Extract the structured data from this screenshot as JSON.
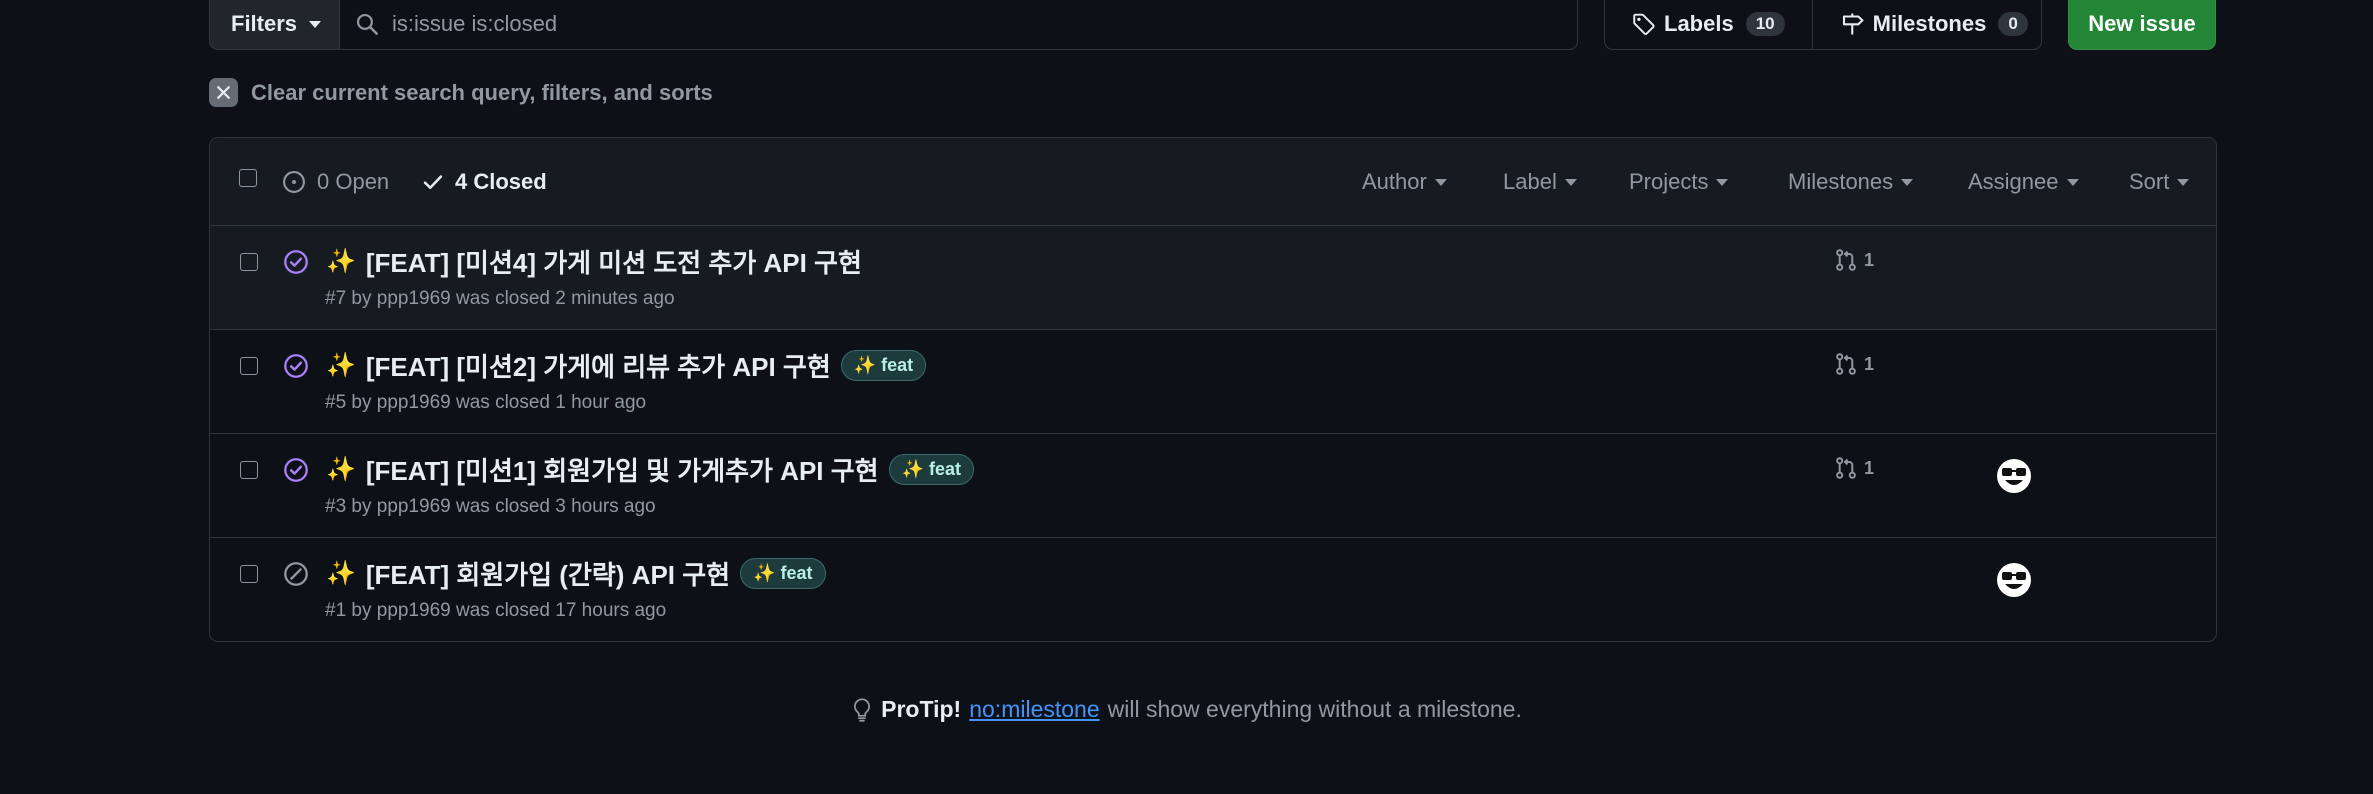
{
  "toolbar": {
    "filters_label": "Filters",
    "search_placeholder": "is:issue is:closed",
    "labels_label": "Labels",
    "labels_count": "10",
    "milestones_label": "Milestones",
    "milestones_count": "0",
    "new_issue_label": "New issue"
  },
  "clear_filters": {
    "label": "Clear current search query, filters, and sorts"
  },
  "issues_header": {
    "open_label": "0 Open",
    "closed_label": "4 Closed",
    "filters": [
      "Author",
      "Label",
      "Projects",
      "Milestones",
      "Assignee",
      "Sort"
    ]
  },
  "issues": [
    {
      "emoji": "✨",
      "title": "[FEAT] [미션4] 가게 미션 도전 추가 API 구현",
      "label": "",
      "meta": "#7 by ppp1969 was closed 2 minutes ago",
      "linked_prs": "1",
      "state": "completed",
      "has_assignee": false
    },
    {
      "emoji": "✨",
      "title": "[FEAT] [미션2] 가게에 리뷰 추가 API 구현",
      "label": "✨ feat",
      "meta": "#5 by ppp1969 was closed 1 hour ago",
      "linked_prs": "1",
      "state": "completed",
      "has_assignee": false
    },
    {
      "emoji": "✨",
      "title": "[FEAT] [미션1] 회원가입 및 가게추가 API 구현",
      "label": "✨ feat",
      "meta": "#3 by ppp1969 was closed 3 hours ago",
      "linked_prs": "1",
      "state": "completed",
      "has_assignee": true
    },
    {
      "emoji": "✨",
      "title": "[FEAT] 회원가입 (간략) API 구현",
      "label": "✨ feat",
      "meta": "#1 by ppp1969 was closed 17 hours ago",
      "linked_prs": "",
      "state": "not_planned",
      "has_assignee": true
    }
  ],
  "protip": {
    "lead": "ProTip!",
    "link": "no:milestone",
    "rest": "will show everything without a milestone."
  },
  "colors": {
    "background": "#0d1117",
    "header_bg": "#161b22",
    "border": "#30363d",
    "muted_text": "#9198a1",
    "primary_button": "#238636",
    "completed_icon": "#ab7df8",
    "not_planned_icon": "#9198a1",
    "link": "#4493f8"
  },
  "icons": {
    "search": "search-icon",
    "labels": "tag-icon",
    "milestones": "milestone-icon",
    "open": "issue-opened-icon",
    "closed": "check-icon",
    "completed": "issue-closed-icon",
    "not_planned": "skip-icon",
    "pr": "git-pull-request-icon",
    "assignee": "avatar",
    "tip": "light-bulb-icon",
    "clear": "x-icon"
  }
}
